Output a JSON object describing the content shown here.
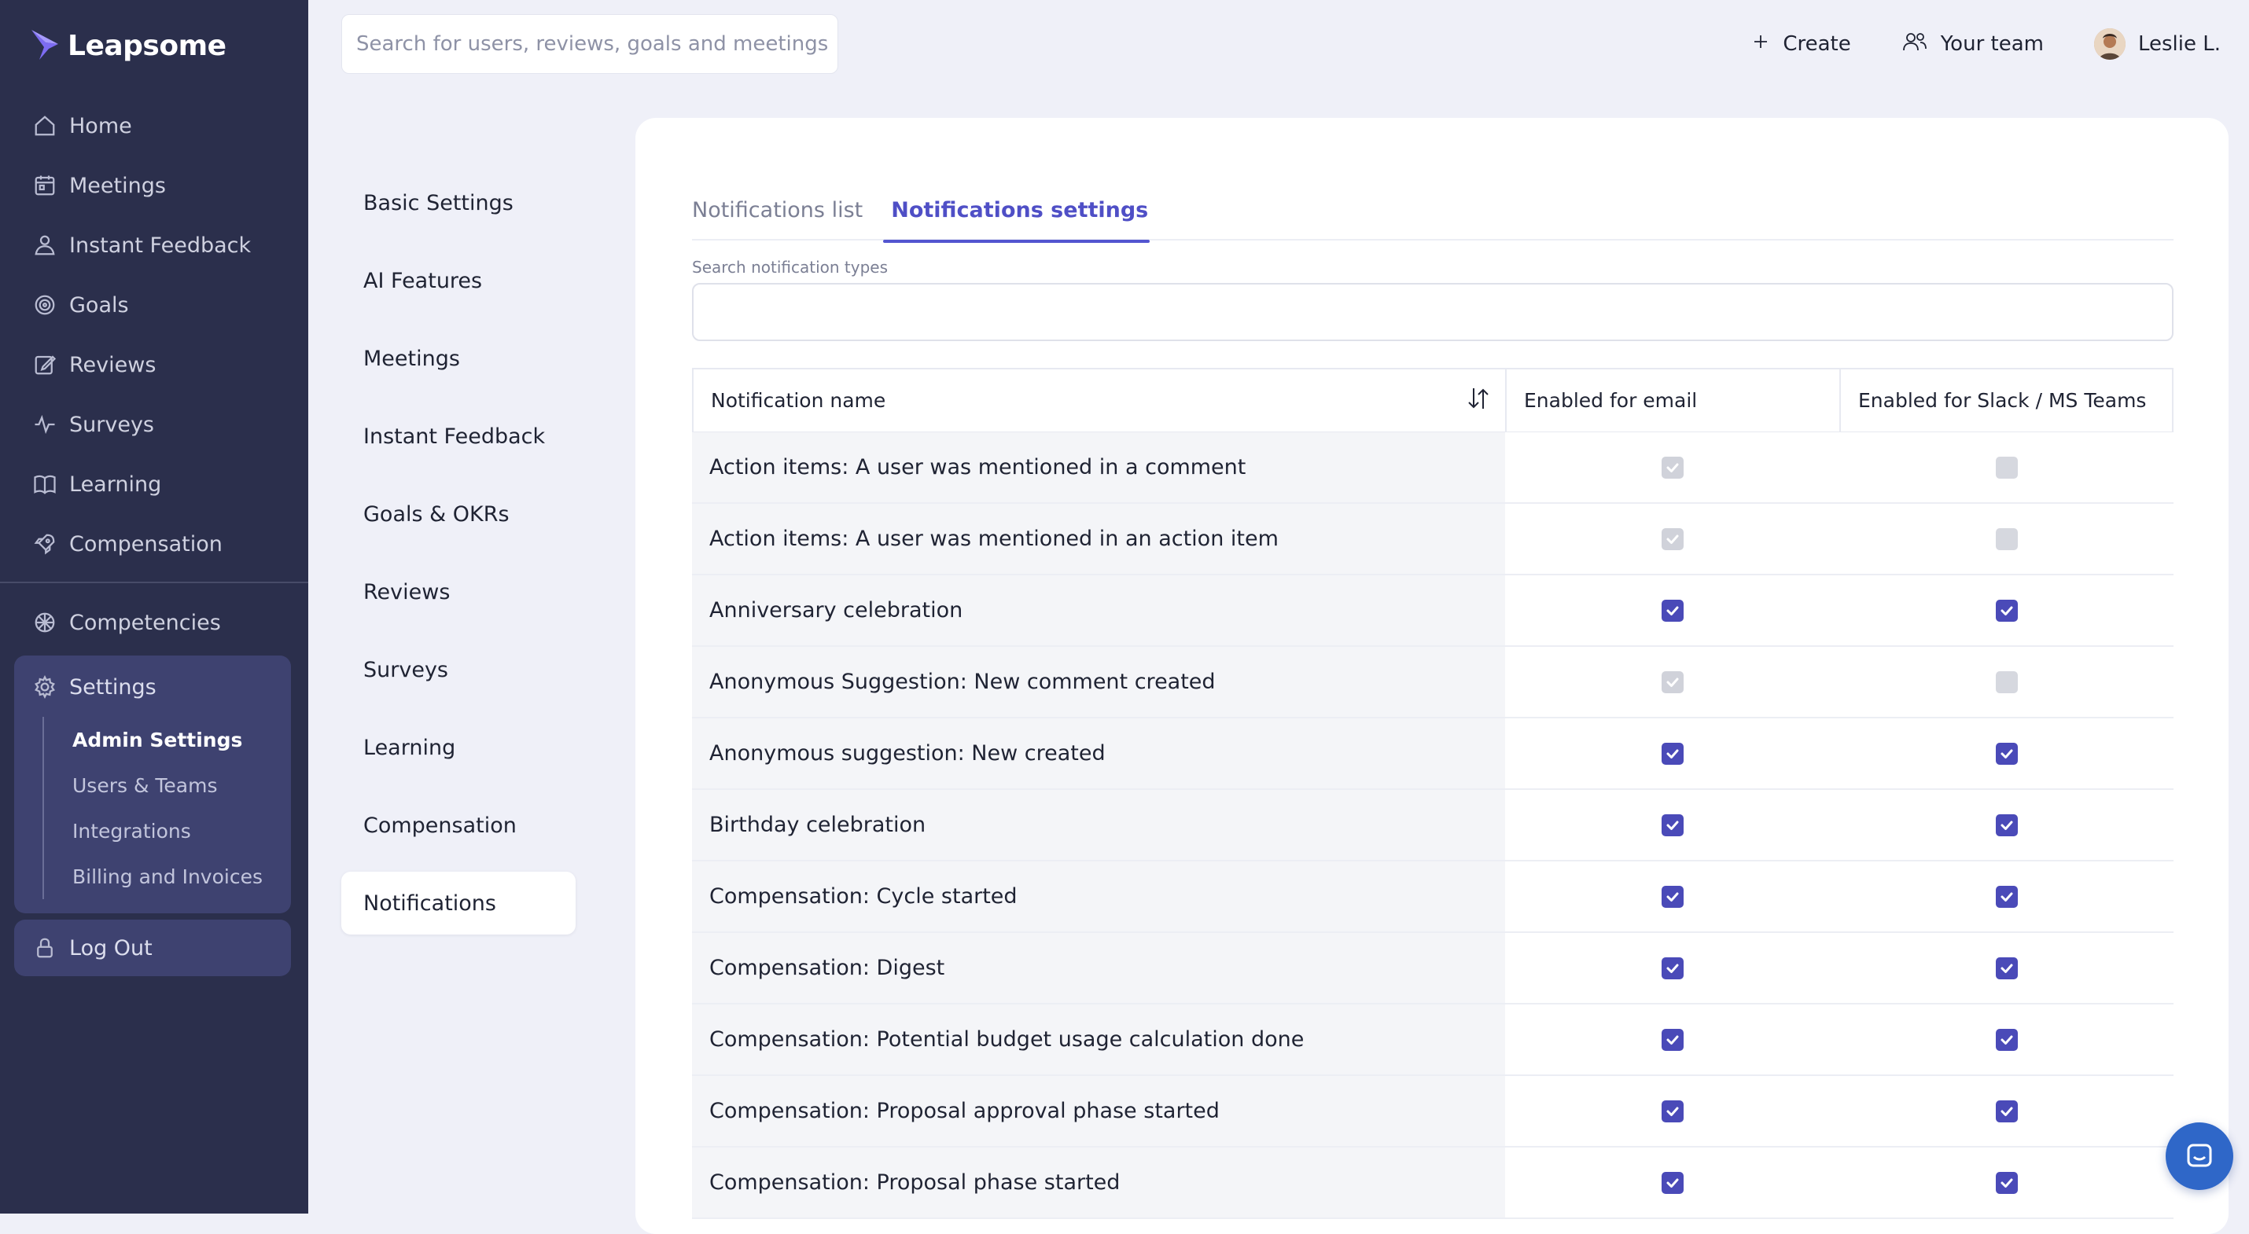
{
  "app": {
    "brand": "Leapsome"
  },
  "sidebar": {
    "main_items": [
      {
        "label": "Home",
        "icon": "home-icon"
      },
      {
        "label": "Meetings",
        "icon": "calendar-icon"
      },
      {
        "label": "Instant Feedback",
        "icon": "feedback-icon"
      },
      {
        "label": "Goals",
        "icon": "target-icon"
      },
      {
        "label": "Reviews",
        "icon": "edit-icon"
      },
      {
        "label": "Surveys",
        "icon": "pulse-icon"
      },
      {
        "label": "Learning",
        "icon": "book-icon"
      },
      {
        "label": "Compensation",
        "icon": "rocket-icon"
      }
    ],
    "competencies": "Competencies",
    "settings": "Settings",
    "settings_sub": [
      "Admin Settings",
      "Users & Teams",
      "Integrations",
      "Billing and Invoices"
    ],
    "settings_active": "Admin Settings",
    "logout": "Log Out"
  },
  "topbar": {
    "search_placeholder": "Search for users, reviews, goals and meetings",
    "create": "Create",
    "your_team": "Your team",
    "user": "Leslie L."
  },
  "submenu": {
    "items": [
      "Basic Settings",
      "AI Features",
      "Meetings",
      "Instant Feedback",
      "Goals & OKRs",
      "Reviews",
      "Surveys",
      "Learning",
      "Compensation",
      "Notifications"
    ],
    "active": "Notifications"
  },
  "tabs": {
    "list": "Notifications list",
    "settings": "Notifications settings",
    "active": "Notifications settings"
  },
  "search_notifications": {
    "label": "Search notification types",
    "value": ""
  },
  "table": {
    "headers": {
      "name": "Notification name",
      "email": "Enabled for email",
      "slack": "Enabled for Slack / MS Teams"
    },
    "rows": [
      {
        "name": "Action items: A user was mentioned in a comment",
        "email": "disabled-on",
        "slack": "disabled-off"
      },
      {
        "name": "Action items: A user was mentioned in an action item",
        "email": "disabled-on",
        "slack": "disabled-off"
      },
      {
        "name": "Anniversary celebration",
        "email": "on",
        "slack": "on"
      },
      {
        "name": "Anonymous Suggestion: New comment created",
        "email": "disabled-on",
        "slack": "disabled-off"
      },
      {
        "name": "Anonymous suggestion: New created",
        "email": "on",
        "slack": "on"
      },
      {
        "name": "Birthday celebration",
        "email": "on",
        "slack": "on"
      },
      {
        "name": "Compensation: Cycle started",
        "email": "on",
        "slack": "on"
      },
      {
        "name": "Compensation: Digest",
        "email": "on",
        "slack": "on"
      },
      {
        "name": "Compensation: Potential budget usage calculation done",
        "email": "on",
        "slack": "on"
      },
      {
        "name": "Compensation: Proposal approval phase started",
        "email": "on",
        "slack": "on"
      },
      {
        "name": "Compensation: Proposal phase started",
        "email": "on",
        "slack": "on"
      }
    ]
  },
  "colors": {
    "sidebar": "#2b2f4c",
    "accent": "#4f4fc6",
    "checkbox": "#4a4ab8",
    "chat": "#2f67c8"
  }
}
